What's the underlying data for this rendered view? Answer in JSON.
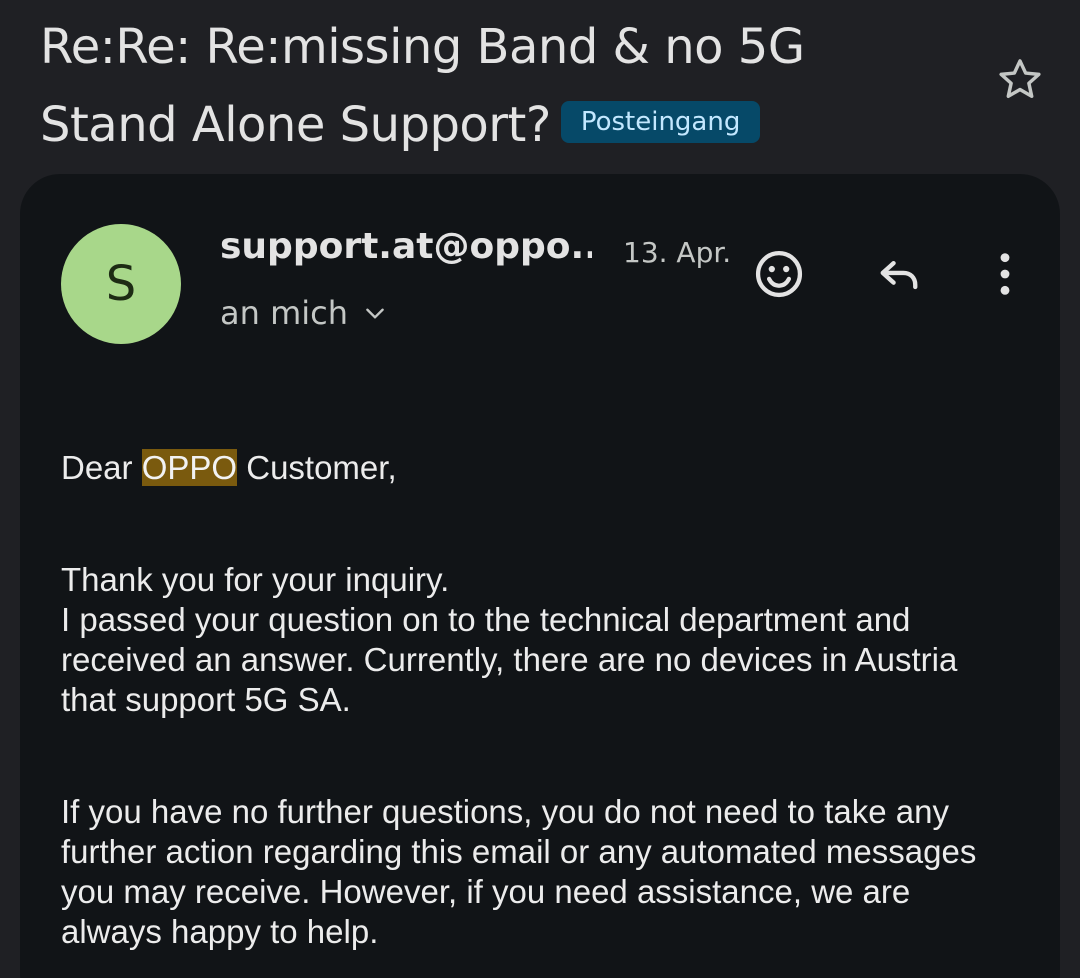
{
  "subject": {
    "line1": "Re:Re: Re:missing Band & no 5G",
    "line2": "Stand Alone Support?",
    "label": "Posteingang"
  },
  "icons": {
    "star": "star-outline-icon",
    "emoji": "add-reaction-icon",
    "reply": "reply-icon",
    "more": "more-vert-icon",
    "expand": "chevron-down-icon"
  },
  "colors": {
    "background": "#1f2024",
    "card": "#111417",
    "label_chip": "#064968",
    "label_text": "#c3e8ff",
    "avatar": "#a8d78a",
    "highlight": "#7a5a0e"
  },
  "message": {
    "avatar_letter": "S",
    "sender": "support.at@oppo....",
    "date": "13. Apr.",
    "recipient": "an mich",
    "body": {
      "greeting_before": "Dear ",
      "greeting_highlight": "OPPO",
      "greeting_after": " Customer,",
      "para2_lines": [
        "Thank you for your inquiry.",
        "I passed your question on to the technical department and",
        "received an answer. Currently, there are no devices in Austria",
        "that support 5G SA."
      ],
      "para3_lines": [
        "If you have no further questions, you do not need to take any",
        "further action regarding this email or any automated messages",
        "you may receive. However, if you need assistance, we are",
        "always happy to help."
      ]
    }
  }
}
